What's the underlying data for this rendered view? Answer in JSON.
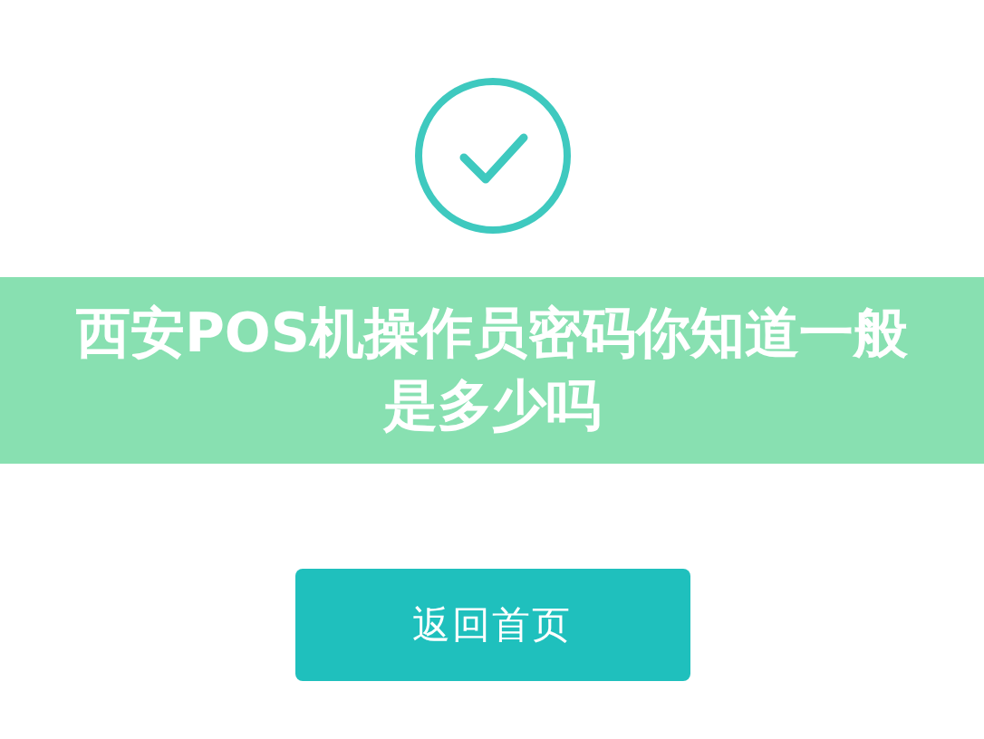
{
  "banner": {
    "title": "西安POS机操作员密码你知道一般是多少吗"
  },
  "buttons": [
    {
      "label": "返回首页"
    }
  ]
}
